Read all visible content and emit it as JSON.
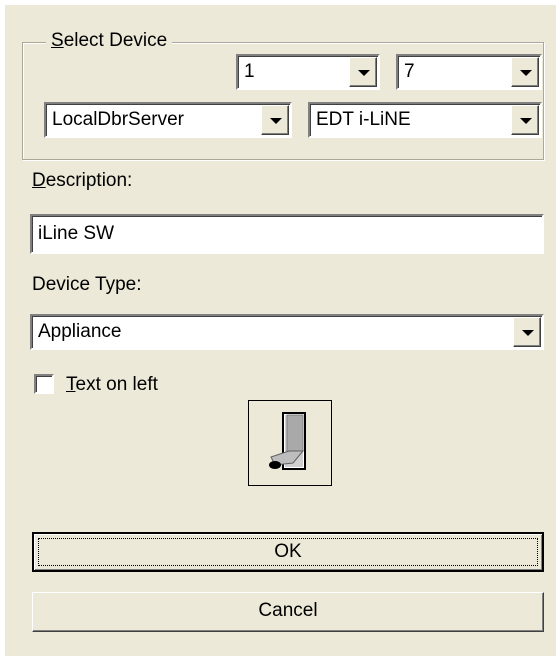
{
  "select_device": {
    "legend_prefix": "",
    "legend_accel": "S",
    "legend_rest": "elect Device",
    "address_primary": "1",
    "address_secondary": "7",
    "server": "LocalDbrServer",
    "model": "EDT i-LiNE"
  },
  "description": {
    "label_accel": "D",
    "label_rest": "escription:",
    "value": "iLine SW"
  },
  "device_type": {
    "label": "Device Type:",
    "value": "Appliance"
  },
  "text_on_left": {
    "label_accel": "T",
    "label_rest": "ext on left",
    "checked": false
  },
  "preview": {
    "icon": "switch-icon"
  },
  "buttons": {
    "ok": "OK",
    "cancel": "Cancel"
  }
}
